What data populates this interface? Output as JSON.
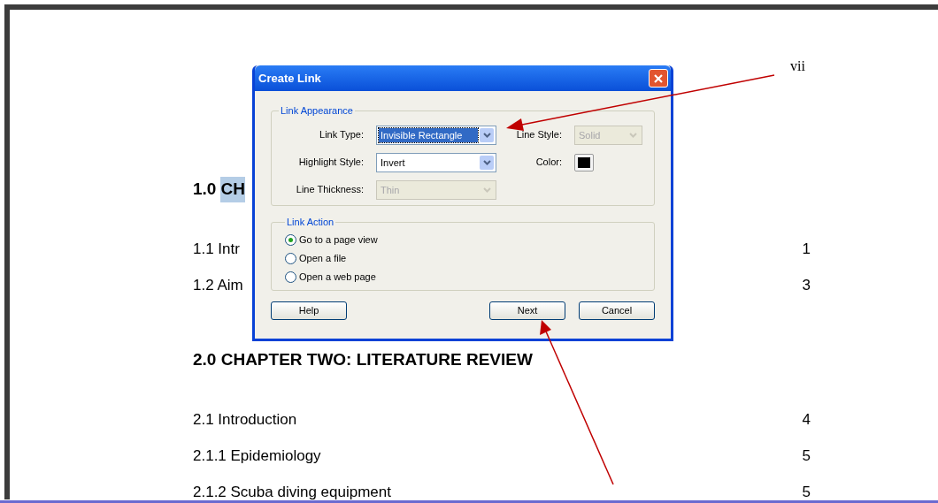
{
  "document": {
    "page_label": "vii",
    "toc": [
      {
        "kind": "heading",
        "text": "1.0",
        "highlighted_text": "CH"
      },
      {
        "kind": "entry",
        "text": "1.1 Intr",
        "page": "1"
      },
      {
        "kind": "entry",
        "text": "1.2 Aim",
        "page": "3"
      },
      {
        "kind": "heading",
        "text": "2.0 CHAPTER TWO: LITERATURE REVIEW"
      },
      {
        "kind": "entry",
        "text": "2.1 Introduction",
        "page": "4"
      },
      {
        "kind": "entry",
        "text": "2.1.1 Epidemiology",
        "page": "5"
      },
      {
        "kind": "entry",
        "text": "2.1.2 Scuba diving equipment",
        "page": "5"
      }
    ]
  },
  "dialog": {
    "title": "Create Link",
    "appearance": {
      "legend": "Link Appearance",
      "fields": [
        {
          "kind": "dropdown",
          "label": "Link Type:",
          "value": "Invisible Rectangle",
          "disabled": false,
          "selected": true
        },
        {
          "kind": "dropdown",
          "label": "Line Style:",
          "value": "Solid",
          "disabled": true,
          "selected": false
        },
        {
          "kind": "dropdown",
          "label": "Highlight Style:",
          "value": "Invert",
          "disabled": false,
          "selected": false
        },
        {
          "kind": "swatch",
          "label": "Color:",
          "color": "#000000"
        },
        {
          "kind": "dropdown",
          "label": "Line Thickness:",
          "value": "Thin",
          "disabled": true,
          "selected": false
        }
      ]
    },
    "action": {
      "legend": "Link Action",
      "options": [
        {
          "label": "Go to a page view",
          "selected": true
        },
        {
          "label": "Open a file",
          "selected": false
        },
        {
          "label": "Open a web page",
          "selected": false
        }
      ]
    },
    "buttons": [
      "Help",
      "Next",
      "Cancel"
    ]
  }
}
